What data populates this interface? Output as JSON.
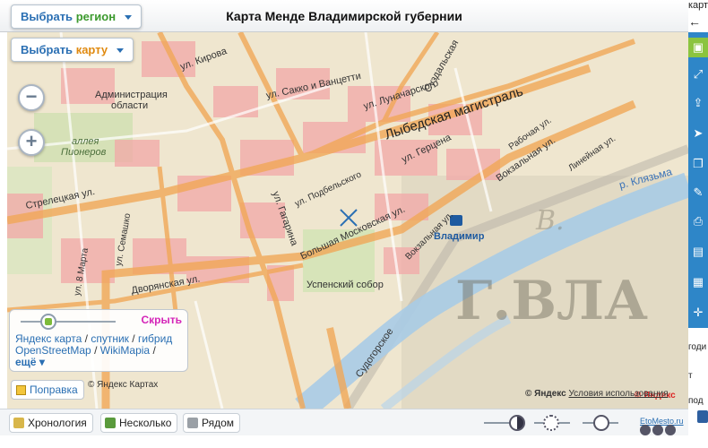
{
  "header": {
    "title": "Карта Менде Владимирской губернии",
    "region_pre": "Выбрать",
    "region_accent": "регион",
    "map_pre": "Выбрать",
    "map_accent": "карту"
  },
  "map": {
    "labels": {
      "kirova": "ул. Кирова",
      "sakko": "ул. Сакко и Ванцетти",
      "admin1": "Администрация",
      "admin2": "области",
      "lunacharskogo": "ул. Луначарского",
      "magistral": "Лыбедская магистраль",
      "alleya1": "аллея",
      "alleya2": "Пионеров",
      "gerzena": "ул. Герцена",
      "podbelskogo": "ул. Подбельского",
      "rabochaya": "Рабочая ул.",
      "vokzalnaya1": "Вокзальная ул.",
      "lineynaya": "Линейная ул.",
      "klyazma": "р. Клязьма",
      "streletskaya": "Стрелецкая ул.",
      "gagarina": "ул. Гагарина",
      "moskovskaya": "Большая Московская ул.",
      "vokzalnaya2": "Вокзальная ул.",
      "vladimir": "Владимир",
      "semashko": "ул. Семашко",
      "marta": "ул. 8 Марта",
      "uspensky": "Успенский собор",
      "dvoryanskaya": "Дворянская ул.",
      "sudogorskoe": "Судогорское",
      "big_text": "Г.ВЛА",
      "suzdalskaya": "Суздальская"
    },
    "zoom_out_symbol": "−",
    "zoom_in_symbol": "+"
  },
  "layers": {
    "hide": "Скрыть",
    "yandex_map": "Яндекс карта",
    "sputnik": "спутник",
    "hybrid": "гибрид",
    "osm": "OpenStreetMap",
    "wikimapia": "WikiMapia",
    "more": "ещё",
    "sep1": "/",
    "sep2": "/",
    "sep3": "/",
    "sep4": "/"
  },
  "fix_button": "Поправка",
  "copyright_left": "© Яндекс Картах",
  "copyright_right_prefix": "© Яндекс",
  "copyright_right_link": "Условия использования",
  "yandex_logo_small": "© Яндекс",
  "yandex_logo_big": "Яндекс",
  "bottom": {
    "chronology": "Хронология",
    "several": "Несколько",
    "nearby": "Рядом",
    "etomesto": "EtoMesto.ru"
  },
  "right_panel": {
    "back": "←",
    "top_text": "карт",
    "text1": "годи",
    "text2": "по",
    "text3": "т",
    "text4": "под"
  },
  "icons": [
    "map-region-icon",
    "expand-icon",
    "share-icon",
    "cursor-icon",
    "copy-icon",
    "ruler-icon",
    "print-icon",
    "image-icon",
    "grid-icon",
    "crosshair-icon"
  ],
  "colors": {
    "accent_blue": "#2a6fb3",
    "accent_green": "#3c9a2e",
    "accent_orange": "#e08a10",
    "hide_pink": "#d424b8",
    "toolbar_blue": "#2e86c8",
    "toolbar_active": "#8bc43f",
    "river": "#9dc3e6",
    "road_orange": "#f0a050",
    "block_pink": "#f2a3a3"
  }
}
